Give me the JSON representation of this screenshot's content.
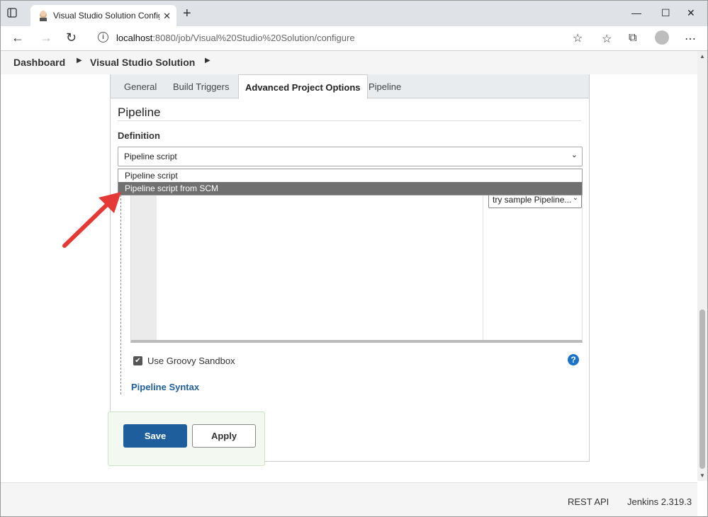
{
  "browser": {
    "tab_title": "Visual Studio Solution Config [Je",
    "url_host": "localhost",
    "url_path": ":8080/job/Visual%20Studio%20Solution/configure"
  },
  "breadcrumb": {
    "items": [
      {
        "label": "Dashboard"
      },
      {
        "label": "Visual Studio Solution"
      }
    ]
  },
  "config_tabs": [
    {
      "label": "General",
      "active": false
    },
    {
      "label": "Build Triggers",
      "active": false
    },
    {
      "label": "Advanced Project Options",
      "active": true
    },
    {
      "label": "Pipeline",
      "active": false
    }
  ],
  "pipeline": {
    "section_title": "Pipeline",
    "definition_label": "Definition",
    "definition_value": "Pipeline script",
    "dropdown_options": [
      {
        "label": "Pipeline script",
        "highlighted": false
      },
      {
        "label": "Pipeline script from SCM",
        "highlighted": true
      }
    ],
    "sample_select_value": "try sample Pipeline...",
    "groovy_sandbox_label": "Use Groovy Sandbox",
    "groovy_sandbox_checked": true,
    "syntax_link": "Pipeline Syntax"
  },
  "actions": {
    "save_label": "Save",
    "apply_label": "Apply"
  },
  "footer": {
    "rest_api": "REST API",
    "version": "Jenkins 2.319.3"
  },
  "colors": {
    "primary": "#1f5e9c",
    "highlight": "#707070",
    "annotation_arrow": "#e53935"
  }
}
